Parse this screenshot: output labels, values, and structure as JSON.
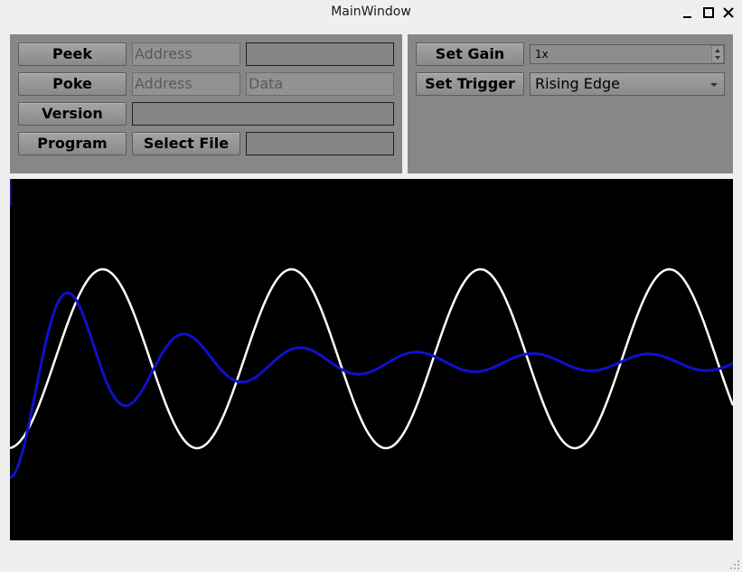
{
  "window": {
    "title": "MainWindow"
  },
  "left_panel": {
    "peek": {
      "button": "Peek",
      "address_placeholder": "Address",
      "result": ""
    },
    "poke": {
      "button": "Poke",
      "address_placeholder": "Address",
      "data_placeholder": "Data"
    },
    "version": {
      "button": "Version",
      "value": ""
    },
    "program": {
      "button": "Program",
      "select_file": "Select File",
      "file_path": ""
    }
  },
  "right_panel": {
    "gain": {
      "button": "Set Gain",
      "value": "1x"
    },
    "trigger": {
      "button": "Set Trigger",
      "value": "Rising Edge"
    }
  },
  "scope": {
    "background": "#000000",
    "white_trace_color": "#ffffff",
    "blue_trace_color": "#1010cc"
  }
}
